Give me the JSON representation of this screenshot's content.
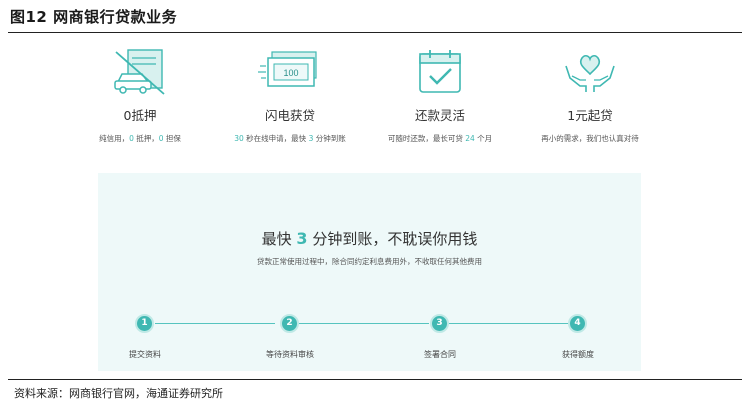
{
  "figure": {
    "title": "图12 网商银行贷款业务",
    "source": "资料来源：网商银行官网，海通证券研究所"
  },
  "features": [
    {
      "icon": "car-with-strike-icon",
      "title": "0抵押",
      "desc_parts": [
        "纯信用，",
        "0",
        " 抵押，",
        "0",
        " 担保"
      ]
    },
    {
      "icon": "banknotes-icon",
      "title": "闪电获贷",
      "desc_parts": [
        "30",
        " 秒在线申请，最快 ",
        "3",
        " 分钟到账"
      ],
      "note_amount": "100"
    },
    {
      "icon": "calendar-check-icon",
      "title": "还款灵活",
      "desc_parts": [
        "可随时还款，最长可贷 ",
        "24",
        " 个月"
      ]
    },
    {
      "icon": "hands-heart-icon",
      "title": "1元起贷",
      "desc_parts": [
        "再小的需求，我们也认真对待"
      ]
    }
  ],
  "panel": {
    "headline_pre": "最快 ",
    "headline_num": "3",
    "headline_post": " 分钟到账，不耽误你用钱",
    "subline": "贷款正常使用过程中，除合同约定利息费用外，不收取任何其他费用",
    "steps": [
      {
        "num": "1",
        "label": "提交资料"
      },
      {
        "num": "2",
        "label": "等待资料审核"
      },
      {
        "num": "3",
        "label": "签署合同"
      },
      {
        "num": "4",
        "label": "获得额度"
      }
    ]
  },
  "colors": {
    "accent": "#3fb8b2",
    "panel_bg": "#eef9f9"
  }
}
